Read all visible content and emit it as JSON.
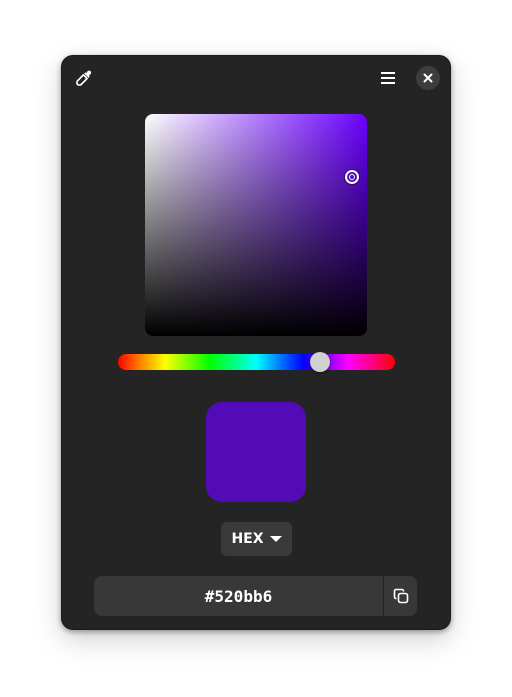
{
  "app": {
    "current_color": "#520bb6",
    "hue_color": "#6a00ff"
  },
  "header": {
    "picker_icon": "eyedropper-icon",
    "menu_icon": "hamburger-menu-icon",
    "close_icon": "close-icon"
  },
  "hue": {
    "level_fraction": 0.74
  },
  "saturation_value": {
    "saturation": 0.94,
    "value": 0.71
  },
  "format": {
    "selected": "HEX"
  },
  "value": {
    "text": "#520bb6",
    "copy_icon": "copy-icon"
  }
}
